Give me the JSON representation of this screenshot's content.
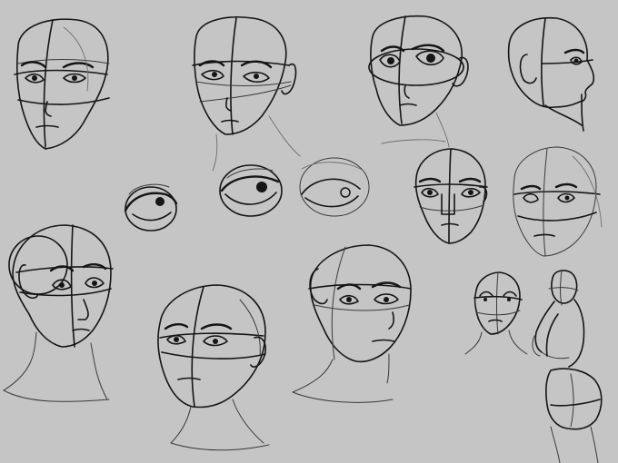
{
  "canvas": {
    "background": "#c5c5c5",
    "ink": "#151515"
  },
  "sketches": [
    {
      "name": "head-front-1",
      "view": "front"
    },
    {
      "name": "head-front-2",
      "view": "front"
    },
    {
      "name": "head-three-quarter-1",
      "view": "three-quarter"
    },
    {
      "name": "head-profile",
      "view": "profile"
    },
    {
      "name": "eye-study-1",
      "view": "eye"
    },
    {
      "name": "eye-study-2",
      "view": "eye"
    },
    {
      "name": "eye-study-3",
      "view": "eye"
    },
    {
      "name": "head-front-3",
      "view": "front"
    },
    {
      "name": "head-three-quarter-2",
      "view": "three-quarter"
    },
    {
      "name": "head-three-quarter-3",
      "view": "three-quarter"
    },
    {
      "name": "head-tilted",
      "view": "three-quarter"
    },
    {
      "name": "head-three-quarter-4",
      "view": "three-quarter"
    },
    {
      "name": "head-small",
      "view": "front"
    },
    {
      "name": "figure-back",
      "view": "figure"
    }
  ]
}
